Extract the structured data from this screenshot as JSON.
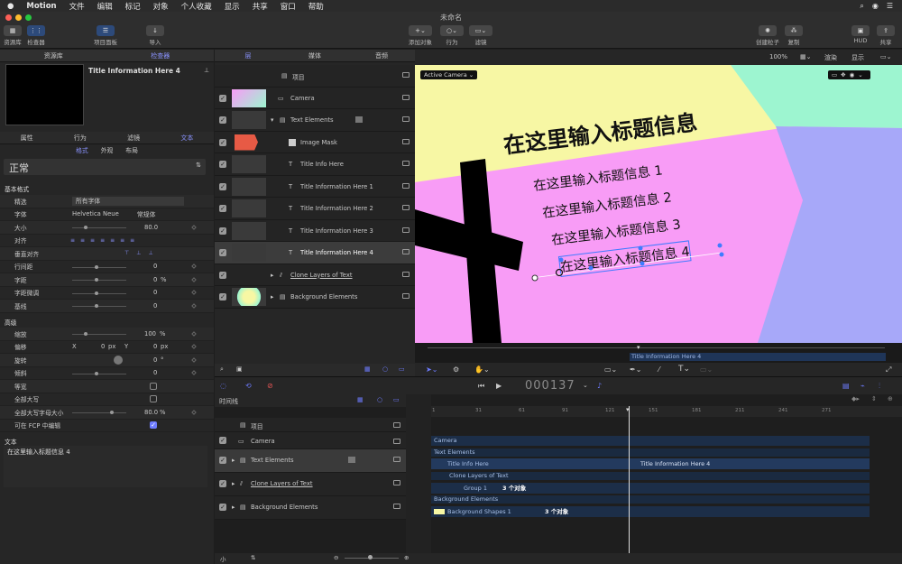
{
  "menubar": {
    "app": "Motion",
    "items": [
      "文件",
      "编辑",
      "标记",
      "对象",
      "个人收藏",
      "显示",
      "共享",
      "窗口",
      "帮助"
    ]
  },
  "window": {
    "title": "未命名"
  },
  "toolbar": {
    "library": "资源库",
    "inspector": "检查器",
    "project_panel": "项目面板",
    "import": "导入",
    "add_object": "添加对象",
    "behaviors": "行为",
    "filters": "滤镜",
    "create_particles": "创建粒子",
    "replicate": "复制",
    "hud": "HUD",
    "share": "共享"
  },
  "left": {
    "tabs": [
      "资源库",
      "检查器"
    ],
    "preview_title": "Title Information Here 4",
    "subtabs": [
      "属性",
      "行为",
      "滤镜",
      "文本"
    ],
    "subsubtabs": [
      "格式",
      "外观",
      "布局"
    ],
    "preset": "正常",
    "basic_format": "基本格式",
    "rows": [
      {
        "label": "精选",
        "value": "所有字体"
      },
      {
        "label": "字体",
        "value": "Helvetica Neue",
        "value2": "常规体"
      },
      {
        "label": "大小",
        "value": "80.0"
      },
      {
        "label": "对齐",
        "value": ""
      },
      {
        "label": "垂直对齐",
        "value": ""
      },
      {
        "label": "行间距",
        "value": "0"
      },
      {
        "label": "字距",
        "value": "0",
        "unit": "%"
      },
      {
        "label": "字距微调",
        "value": "0"
      },
      {
        "label": "基线",
        "value": "0"
      }
    ],
    "advanced": "高级",
    "adv_rows": [
      {
        "label": "缩放",
        "value": "100",
        "unit": "%"
      },
      {
        "label": "偏移",
        "x_label": "X",
        "x": "0",
        "x_unit": "px",
        "y_label": "Y",
        "y": "0",
        "y_unit": "px"
      },
      {
        "label": "旋转",
        "value": "0",
        "unit": "°"
      },
      {
        "label": "倾斜",
        "value": "0"
      },
      {
        "label": "等宽",
        "value": ""
      },
      {
        "label": "全部大写",
        "value": ""
      },
      {
        "label": "全部大写字母大小",
        "value": "80.0",
        "unit": "%"
      },
      {
        "label": "可在 FCP 中编辑",
        "value": ""
      }
    ],
    "text_section": "文本",
    "text_value": "在这里输入标题信息 4"
  },
  "layers": {
    "tabs": [
      "层",
      "媒体",
      "音频"
    ],
    "project": "项目",
    "items": [
      "Camera",
      "Text Elements",
      "Image Mask",
      "Title Info Here",
      "Title Information Here 1",
      "Title Information Here 2",
      "Title Information Here 3",
      "Title Information Here 4",
      "Clone Layers of Text",
      "Background Elements"
    ]
  },
  "viewer": {
    "camera": "Active Camera",
    "zoom": "100%",
    "render": "渲染",
    "view": "显示",
    "title": "在这里输入标题信息",
    "lines": [
      "在这里输入标题信息 1",
      "在这里输入标题信息 2",
      "在这里输入标题信息 3",
      "在这里输入标题信息 4"
    ],
    "mini_label": "Title Information Here 4"
  },
  "transport": {
    "timecode": "000137"
  },
  "timeline": {
    "label": "时间线",
    "project": "项目",
    "rows": [
      "Camera",
      "Text Elements",
      "Clone Layers of Text",
      "Background Elements"
    ],
    "ruler": [
      "1",
      "31",
      "61",
      "91",
      "121",
      "151",
      "181",
      "211",
      "241",
      "271"
    ],
    "bars": [
      {
        "name": "Camera"
      },
      {
        "name": "Text Elements"
      },
      {
        "name": "Title Info Here",
        "extra": "Title Information Here 4"
      },
      {
        "name": "Clone Layers of Text"
      },
      {
        "name": "Group 1",
        "count": "3 个对象"
      },
      {
        "name": "Background Elements"
      },
      {
        "name": "Background Shapes 1",
        "count": "3 个对象"
      }
    ],
    "size": "小"
  },
  "colors": {
    "accent": "#6e7cff",
    "canvas_pink": "#f89cf6",
    "canvas_yellow": "#f7f7a4",
    "canvas_blue": "#a7a8f9",
    "canvas_mint": "#9df5d0"
  }
}
